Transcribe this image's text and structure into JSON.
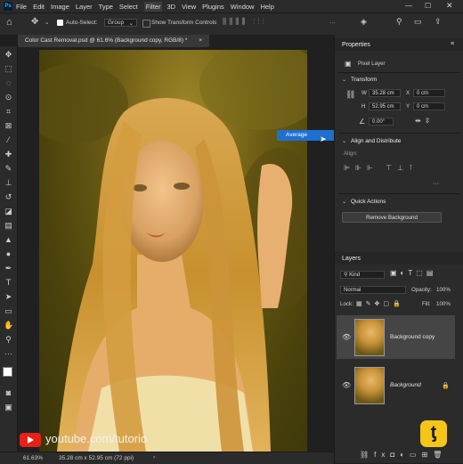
{
  "menu": {
    "logo": "Ps",
    "items": [
      "File",
      "Edit",
      "Image",
      "Layer",
      "Type",
      "Select",
      "Filter",
      "3D",
      "View",
      "Plugins",
      "Window",
      "Help"
    ],
    "active": "Filter"
  },
  "options_bar": {
    "auto_select_label": "Auto-Select:",
    "auto_select_value": "Group",
    "transform_label": "Show Transform Controls",
    "more_icon": "more-icon"
  },
  "document": {
    "tab_title": "Color Cast Removal.psd @ 61.6% (Background copy, RGB/8) *",
    "close": "×"
  },
  "status": {
    "zoom": "61.63%",
    "dimensions": "35.28 cm x 52.95 cm (72 ppi)"
  },
  "context_popup": {
    "label": "Average"
  },
  "properties": {
    "title": "Properties",
    "layer_type": "Pixel Layer",
    "transform_title": "Transform",
    "w_label": "W",
    "w_value": "35.28 cm",
    "h_label": "H",
    "h_value": "52.95 cm",
    "x_label": "X",
    "x_value": "0 cm",
    "y_label": "Y",
    "y_value": "0 cm",
    "angle_value": "0.00°",
    "align_title": "Align and Distribute",
    "align_label": "Align:",
    "quick_title": "Quick Actions",
    "remove_bg_button": "Remove Background"
  },
  "layers": {
    "title": "Layers",
    "kind": "Kind",
    "blend_mode": "Normal",
    "opacity_label": "Opacity:",
    "opacity_value": "100%",
    "lock_label": "Lock:",
    "fill_label": "Fill:",
    "fill_value": "100%",
    "items": [
      {
        "name": "Background copy",
        "selected": true
      },
      {
        "name": "Background",
        "selected": false
      }
    ]
  },
  "watermark": {
    "text": "youtube.com/tutorio"
  },
  "colors": {
    "accent": "#1f6fd1",
    "ps_blue": "#31a8ff",
    "yt_red": "#e62117",
    "logo_yellow": "#f5c518"
  }
}
